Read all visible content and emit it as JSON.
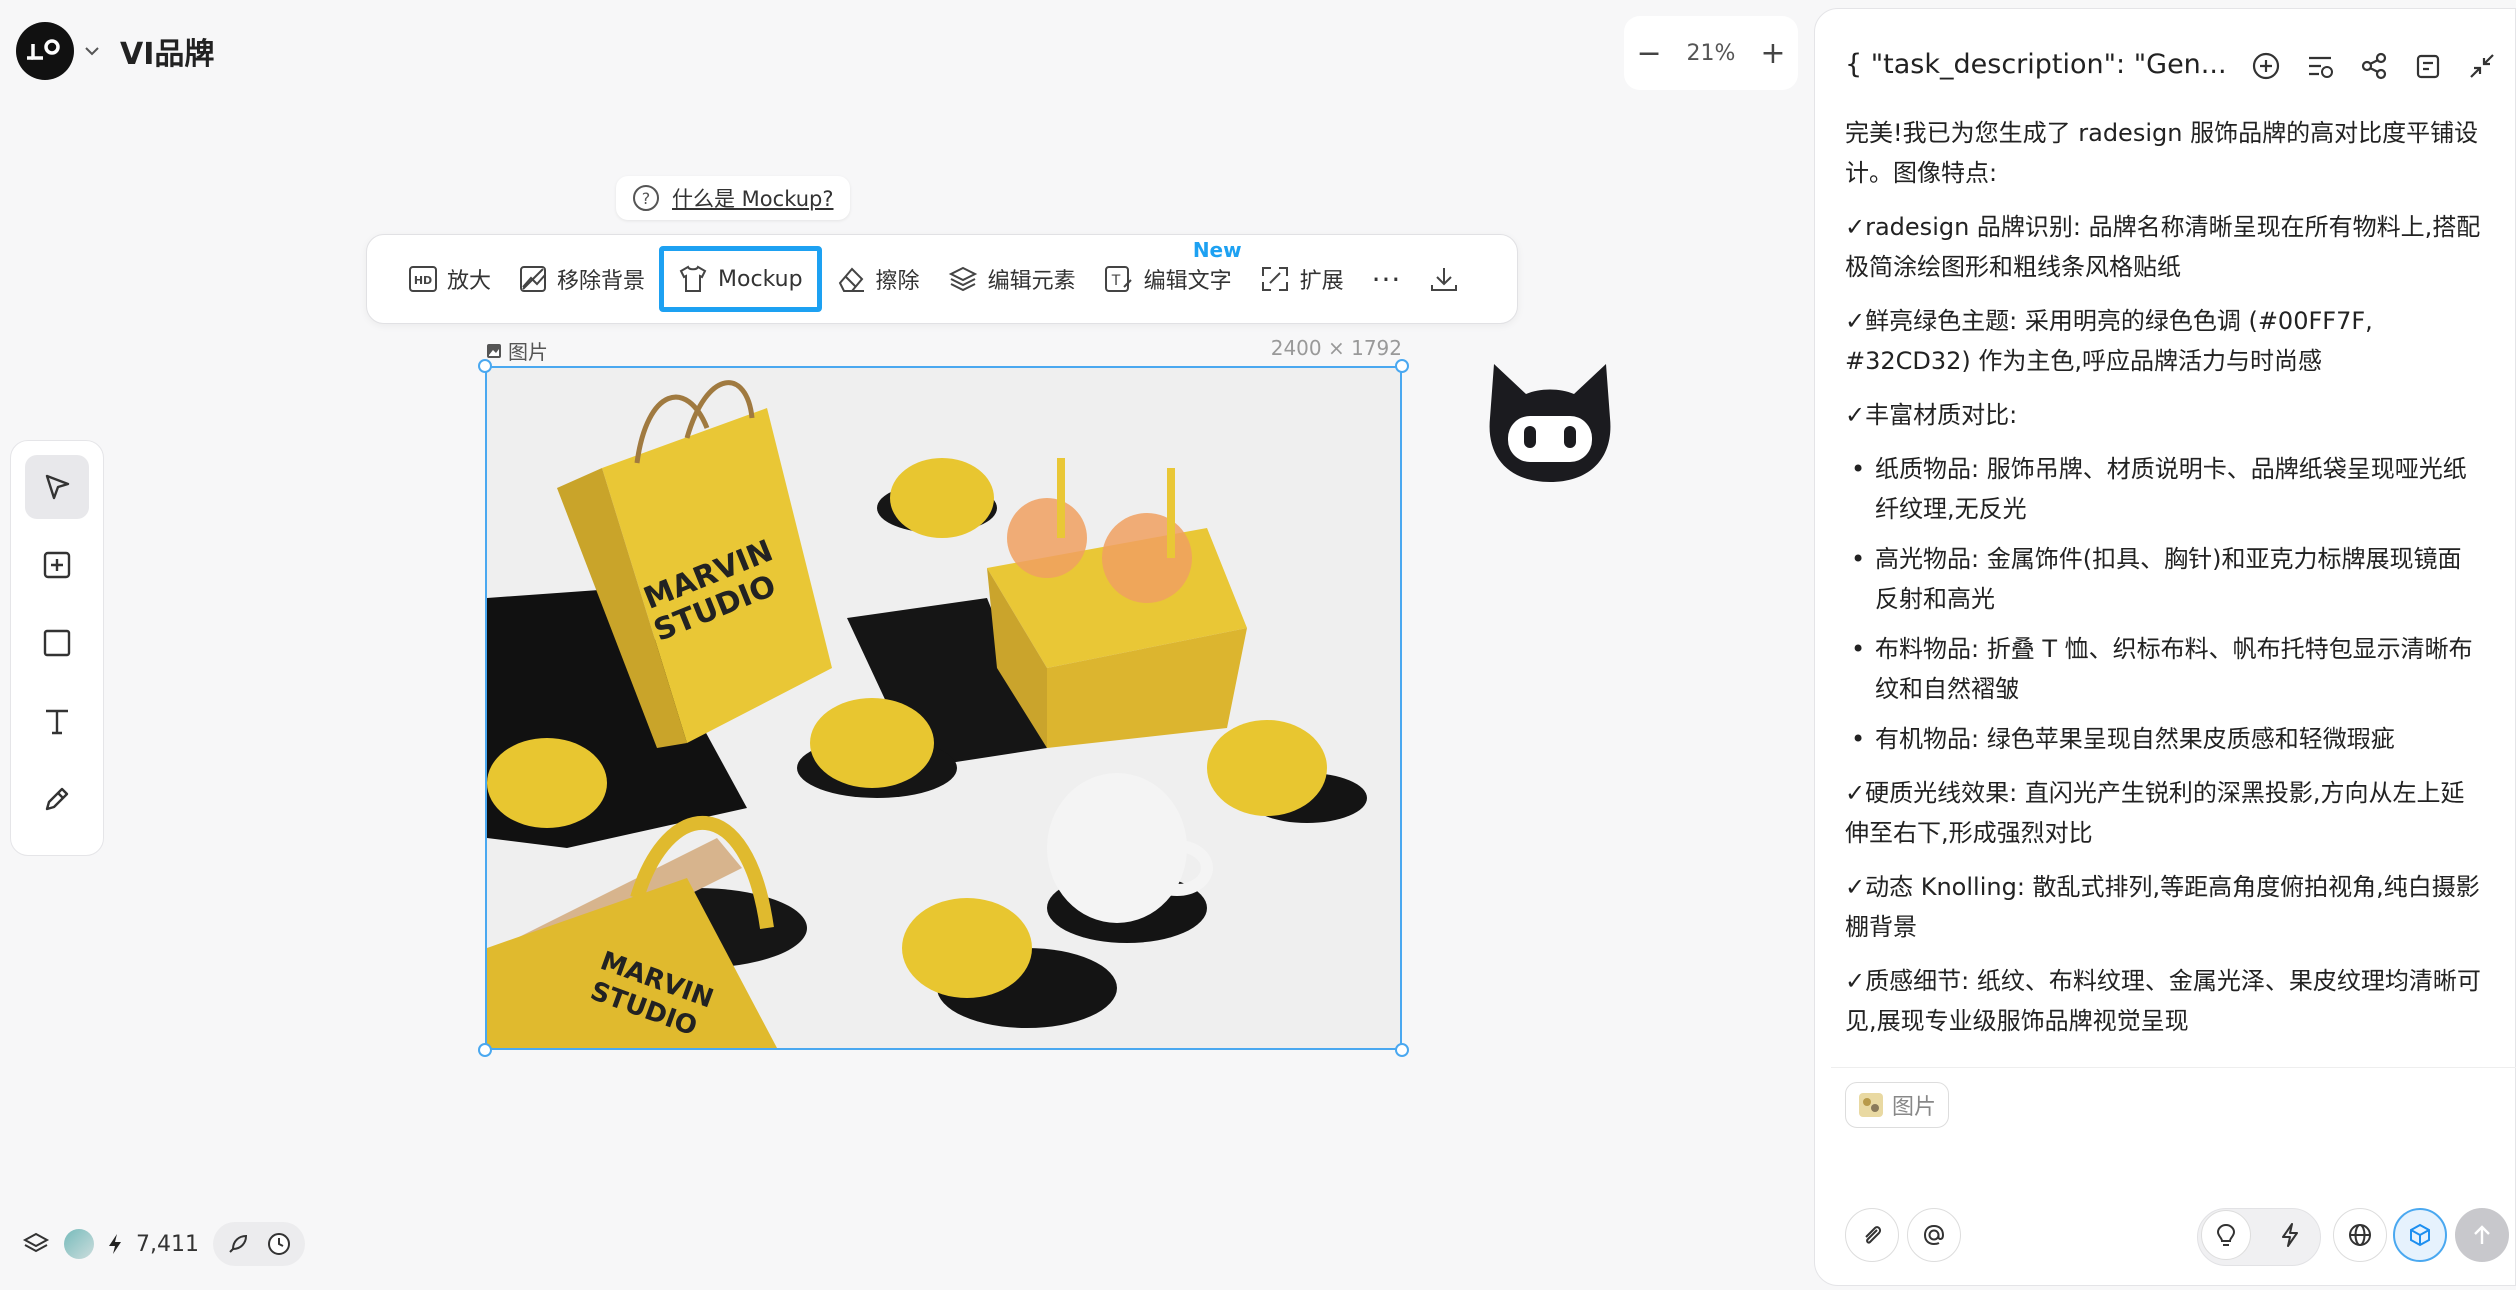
{
  "project": {
    "title": "VI品牌"
  },
  "zoom": {
    "minus": "−",
    "value": "21%",
    "plus": "+"
  },
  "hint": {
    "label": "什么是 Mockup?"
  },
  "toolbar": {
    "upscale": "放大",
    "remove_bg": "移除背景",
    "mockup": "Mockup",
    "erase": "擦除",
    "edit_elements": "编辑元素",
    "edit_text": "编辑文字",
    "new_badge": "New",
    "expand": "扩展",
    "more": "···"
  },
  "image": {
    "label": "图片",
    "size": "2400 × 1792"
  },
  "bottom": {
    "credits": "7,411"
  },
  "panel": {
    "title": "{ \"task_description\": \"Gen...",
    "intro": "完美!我已为您生成了 radesign 服饰品牌的高对比度平铺设计。图像特点:",
    "p1": "✓radesign 品牌识别: 品牌名称清晰呈现在所有物料上,搭配极简涂绘图形和粗线条风格贴纸",
    "p2": "✓鲜亮绿色主题: 采用明亮的绿色色调 (#00FF7F, #32CD32) 作为主色,呼应品牌活力与时尚感",
    "p3": "✓丰富材质对比:",
    "list": [
      "纸质物品: 服饰吊牌、材质说明卡、品牌纸袋呈现哑光纸纤纹理,无反光",
      "高光物品: 金属饰件(扣具、胸针)和亚克力标牌展现镜面反射和高光",
      "布料物品: 折叠 T 恤、织标布料、帆布托特包显示清晰布纹和自然褶皱",
      "有机物品: 绿色苹果呈现自然果皮质感和轻微瑕疵"
    ],
    "p4": "✓硬质光线效果: 直闪光产生锐利的深黑投影,方向从左上延伸至右下,形成强烈对比",
    "p5": "✓动态 Knolling: 散乱式排列,等距高角度俯拍视角,纯白摄影棚背景",
    "p6": "✓质感细节: 纸纹、布料纹理、金属光泽、果皮纹理均清晰可见,展现专业级服饰品牌视觉呈现",
    "chip_label": "图片"
  },
  "colors": {
    "accent": "#1da1f2",
    "mockup_yellow": "#e9c736"
  }
}
